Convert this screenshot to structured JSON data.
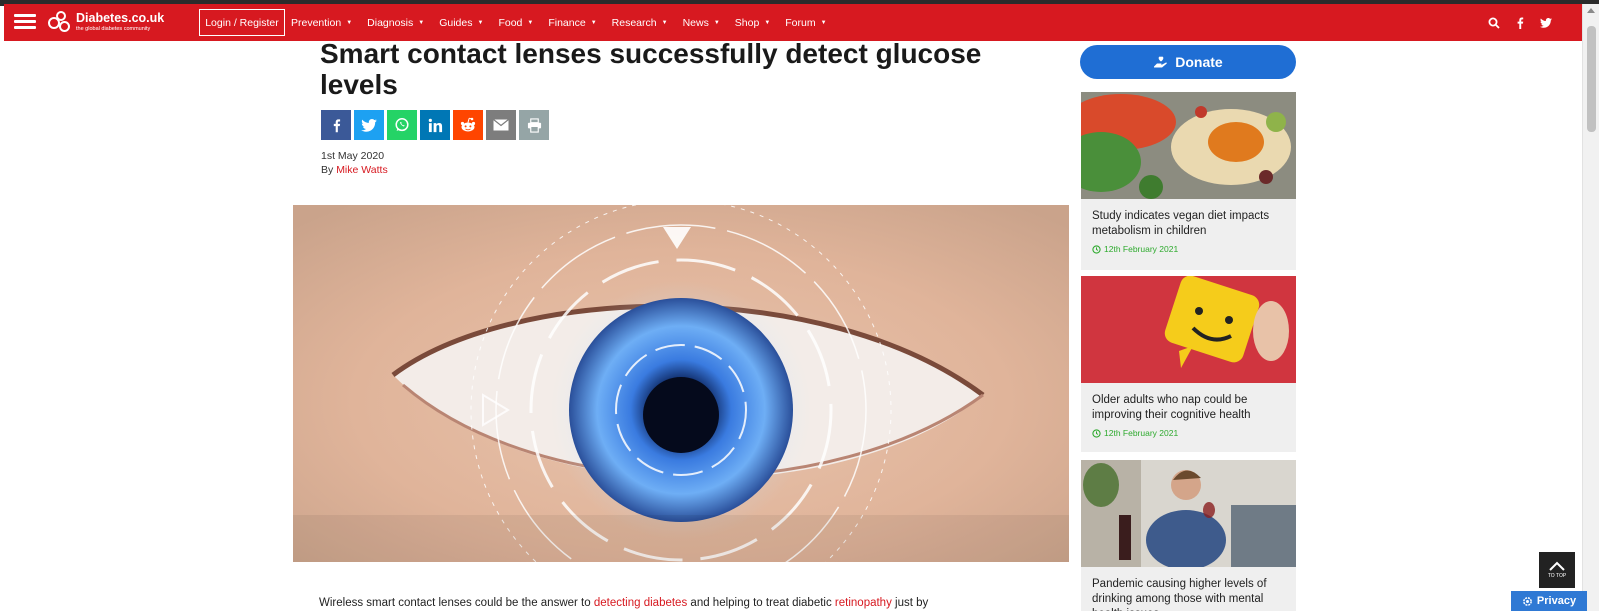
{
  "nav": {
    "logo_name": "Diabetes.co.uk",
    "logo_tagline": "the global diabetes community",
    "login_label": "Login / Register",
    "menu": [
      {
        "label": "Prevention"
      },
      {
        "label": "Diagnosis"
      },
      {
        "label": "Guides"
      },
      {
        "label": "Food"
      },
      {
        "label": "Finance"
      },
      {
        "label": "Research"
      },
      {
        "label": "News"
      },
      {
        "label": "Shop"
      },
      {
        "label": "Forum"
      }
    ],
    "icons": [
      "search-icon",
      "facebook-icon",
      "twitter-icon"
    ],
    "bar_color": "#d71920"
  },
  "article": {
    "title": "Smart contact lenses successfully detect glucose levels",
    "date": "1st May 2020",
    "by_label": "By",
    "author": "Mike Watts",
    "share_buttons": [
      {
        "icon": "facebook-icon",
        "color": "#3b5998"
      },
      {
        "icon": "twitter-icon",
        "color": "#1da1f2"
      },
      {
        "icon": "whatsapp-icon",
        "color": "#25d366"
      },
      {
        "icon": "linkedin-icon",
        "color": "#0077b5"
      },
      {
        "icon": "reddit-icon",
        "color": "#ff4500"
      },
      {
        "icon": "email-icon",
        "color": "#7d7d7d"
      },
      {
        "icon": "print-icon",
        "color": "#95a5a6"
      }
    ],
    "body_intro": "Wireless smart contact lenses could be the answer to",
    "body_link1": "detecting diabetes",
    "body_mid": "and helping to treat diabetic",
    "body_link2": "retinopathy",
    "body_end": "just by"
  },
  "sidebar": {
    "donate_label": "Donate",
    "cards": [
      {
        "title": "Study indicates vegan diet impacts metabolism in children",
        "date": "12th February 2021"
      },
      {
        "title": "Older adults who nap could be improving their cognitive health",
        "date": "12th February 2021"
      },
      {
        "title": "Pandemic causing higher levels of drinking among those with mental health issues",
        "date": ""
      }
    ]
  },
  "widgets": {
    "totop_label": "TO TOP",
    "privacy_label": "Privacy"
  }
}
